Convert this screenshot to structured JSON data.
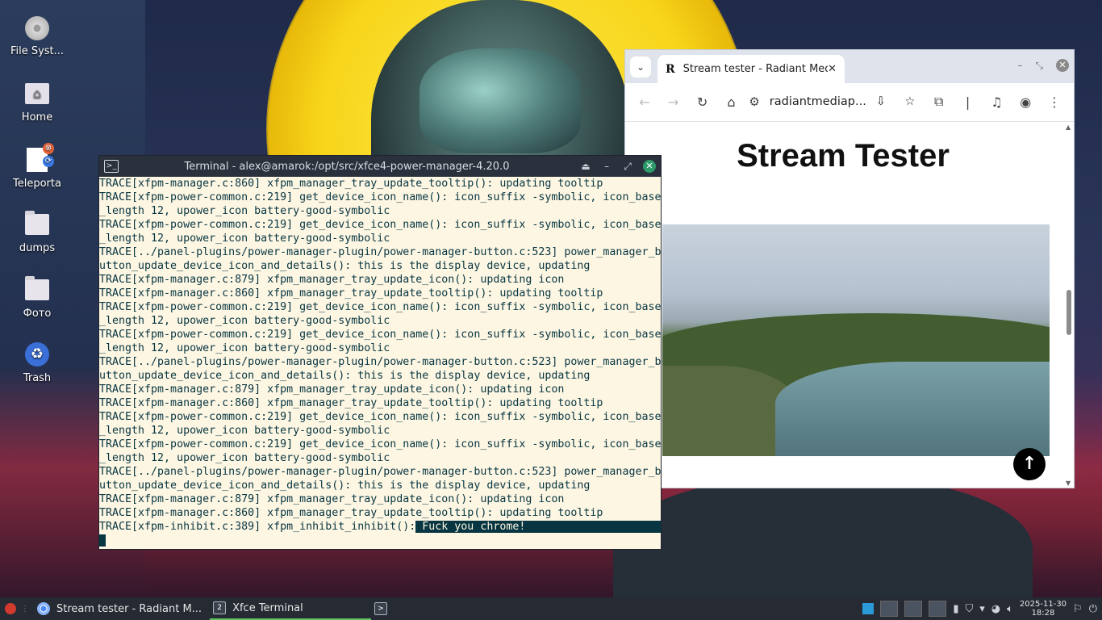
{
  "desktop": {
    "icons": [
      {
        "label": "File Syst...",
        "icon": "drive-icon"
      },
      {
        "label": "Home",
        "icon": "home-folder-icon"
      },
      {
        "label": "Teleporta",
        "icon": "document-icon"
      },
      {
        "label": "dumps",
        "icon": "folder-icon"
      },
      {
        "label": "Фото",
        "icon": "folder-icon"
      },
      {
        "label": "Trash",
        "icon": "trash-icon"
      }
    ]
  },
  "terminal": {
    "title": "Terminal - alex@amarok:/opt/src/xfce4-power-manager-4.20.0",
    "lines": [
      "TRACE[xfpm-manager.c:860] xfpm_manager_tray_update_tooltip(): updating tooltip",
      "TRACE[xfpm-power-common.c:219] get_device_icon_name(): icon_suffix -symbolic, icon_base",
      "_length 12, upower_icon battery-good-symbolic",
      "TRACE[xfpm-power-common.c:219] get_device_icon_name(): icon_suffix -symbolic, icon_base",
      "_length 12, upower_icon battery-good-symbolic",
      "TRACE[../panel-plugins/power-manager-plugin/power-manager-button.c:523] power_manager_b",
      "utton_update_device_icon_and_details(): this is the display device, updating",
      "TRACE[xfpm-manager.c:879] xfpm_manager_tray_update_icon(): updating icon",
      "TRACE[xfpm-manager.c:860] xfpm_manager_tray_update_tooltip(): updating tooltip",
      "TRACE[xfpm-power-common.c:219] get_device_icon_name(): icon_suffix -symbolic, icon_base",
      "_length 12, upower_icon battery-good-symbolic",
      "TRACE[xfpm-power-common.c:219] get_device_icon_name(): icon_suffix -symbolic, icon_base",
      "_length 12, upower_icon battery-good-symbolic",
      "TRACE[../panel-plugins/power-manager-plugin/power-manager-button.c:523] power_manager_b",
      "utton_update_device_icon_and_details(): this is the display device, updating",
      "TRACE[xfpm-manager.c:879] xfpm_manager_tray_update_icon(): updating icon",
      "TRACE[xfpm-manager.c:860] xfpm_manager_tray_update_tooltip(): updating tooltip",
      "TRACE[xfpm-power-common.c:219] get_device_icon_name(): icon_suffix -symbolic, icon_base",
      "_length 12, upower_icon battery-good-symbolic",
      "TRACE[xfpm-power-common.c:219] get_device_icon_name(): icon_suffix -symbolic, icon_base",
      "_length 12, upower_icon battery-good-symbolic",
      "TRACE[../panel-plugins/power-manager-plugin/power-manager-button.c:523] power_manager_b",
      "utton_update_device_icon_and_details(): this is the display device, updating",
      "TRACE[xfpm-manager.c:879] xfpm_manager_tray_update_icon(): updating icon",
      "TRACE[xfpm-manager.c:860] xfpm_manager_tray_update_tooltip(): updating tooltip"
    ],
    "last_line_prefix": "TRACE[xfpm-inhibit.c:389] xfpm_inhibit_inhibit():",
    "last_line_selected": " Fuck you chrome!                      "
  },
  "chrome": {
    "tab_title": "Stream tester - Radiant Med",
    "favicon": "R",
    "url": "radiantmediap...",
    "page_heading": "Stream Tester"
  },
  "taskbar": {
    "tasks": [
      {
        "label": "Stream tester - Radiant M...",
        "icon": "chrome-icon"
      },
      {
        "label": "Xfce Terminal",
        "icon": "terminal-icon",
        "badge": "2"
      }
    ],
    "clock_date": "2025-11-30",
    "clock_time": "18:28"
  },
  "colors": {
    "terminal_bg": "#fdf6e3",
    "terminal_fg": "#073642",
    "titlebar": "#2a313c",
    "taskbar": "#252a33"
  }
}
